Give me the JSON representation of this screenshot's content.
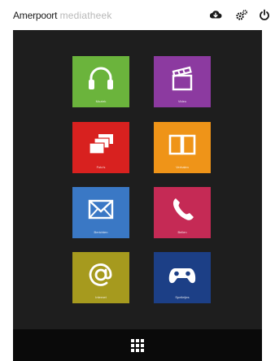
{
  "header": {
    "brand_main": "Amerpoort",
    "brand_sub": "mediatheek",
    "icons": [
      "cloud-download-icon",
      "settings-icon",
      "power-icon"
    ]
  },
  "tiles": [
    {
      "label": "Muziek",
      "icon": "headphones-icon",
      "color": "#6bb43c"
    },
    {
      "label": "Video",
      "icon": "clapperboard-icon",
      "color": "#8c3aa0"
    },
    {
      "label": "Foto's",
      "icon": "photos-icon",
      "color": "#d8211f"
    },
    {
      "label": "Verhalen",
      "icon": "book-icon",
      "color": "#ef9418"
    },
    {
      "label": "Berichten",
      "icon": "envelope-icon",
      "color": "#3a78c5"
    },
    {
      "label": "Bellen",
      "icon": "phone-icon",
      "color": "#c52a55"
    },
    {
      "label": "Internet",
      "icon": "at-sign-icon",
      "color": "#a69a1e"
    },
    {
      "label": "Spelletjes",
      "icon": "gamepad-icon",
      "color": "#1c3f86"
    }
  ],
  "bottombar": {
    "icon": "app-grid-icon"
  }
}
